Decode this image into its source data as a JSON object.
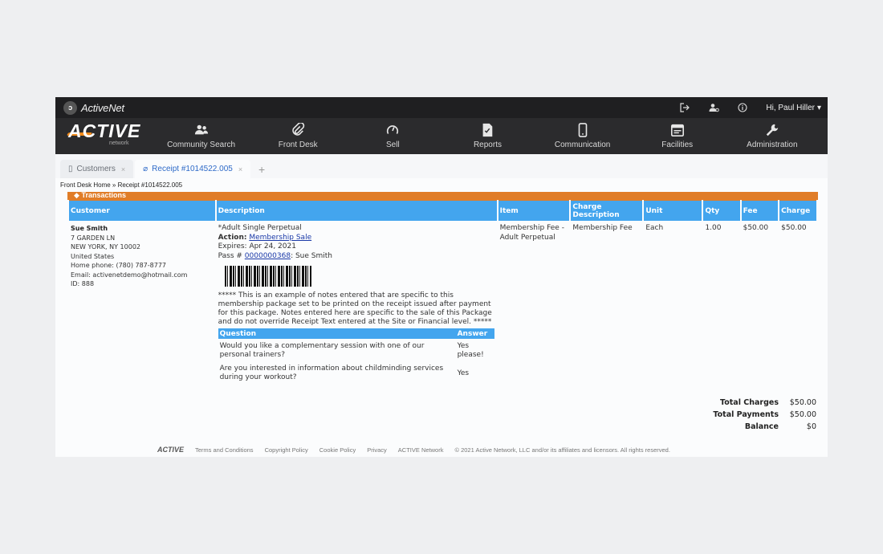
{
  "topbar": {
    "brand": "ActiveNet",
    "greeting": "Hi, Paul Hiller"
  },
  "logo": {
    "main": "ACTIVE",
    "sub": "network"
  },
  "nav": [
    {
      "label": "Community Search",
      "icon": "people-icon"
    },
    {
      "label": "Front Desk",
      "icon": "paperclip-icon"
    },
    {
      "label": "Sell",
      "icon": "gauge-icon"
    },
    {
      "label": "Reports",
      "icon": "report-icon"
    },
    {
      "label": "Communication",
      "icon": "phone-icon"
    },
    {
      "label": "Facilities",
      "icon": "calendar-icon"
    },
    {
      "label": "Administration",
      "icon": "wrench-icon"
    }
  ],
  "tabs": [
    {
      "label": "Customers",
      "active": false
    },
    {
      "label": "Receipt #1014522.005",
      "active": true
    }
  ],
  "breadcrumb": "Front Desk Home » Receipt #1014522.005",
  "section_title": "Transactions",
  "table": {
    "headers": [
      "Customer",
      "Description",
      "Item",
      "Charge Description",
      "Unit",
      "Qty",
      "Fee",
      "Charge"
    ],
    "customer": {
      "name": "Sue Smith",
      "lines": [
        "7 GARDEN LN",
        "NEW YORK, NY 10002",
        "United States",
        "Home phone: (780) 787-8777",
        "Email: activenetdemo@hotmail.com",
        "ID: 888"
      ]
    },
    "description": {
      "title": "*Adult Single Perpetual",
      "action_label": "Action:",
      "action_link": "Membership Sale",
      "expires": "Expires: Apr 24, 2021",
      "pass_label": "Pass #",
      "pass_link": "0000000368",
      "pass_name": ": Sue Smith",
      "notes": "***** This is an example of notes entered that are specific to this membership package set to be printed on the receipt issued after payment for this package. Notes entered here are specific to the sale of this Package and do not override Receipt Text entered at the Site or Financial level. *****",
      "qa_headers": [
        "Question",
        "Answer"
      ],
      "qa": [
        {
          "q": "Would you like a complementary session with one of our personal trainers?",
          "a": "Yes please!"
        },
        {
          "q": "Are you interested in information about childminding services during your workout?",
          "a": "Yes"
        }
      ]
    },
    "item": "Membership Fee - Adult Perpetual",
    "charge_description": "Membership Fee",
    "unit": "Each",
    "qty": "1.00",
    "fee": "$50.00",
    "charge": "$50.00"
  },
  "totals": [
    {
      "label": "Total Charges",
      "value": "$50.00"
    },
    {
      "label": "Total Payments",
      "value": "$50.00"
    },
    {
      "label": "Balance",
      "value": "$0"
    }
  ],
  "footer": {
    "logo": "ACTIVE",
    "links": [
      "Terms and Conditions",
      "Copyright Policy",
      "Cookie Policy",
      "Privacy",
      "ACTIVE Network"
    ],
    "copyright": "© 2021 Active Network, LLC and/or its affiliates and licensors. All rights reserved."
  },
  "colors": {
    "accent": "#43a5ee",
    "orange": "#e07d28",
    "header": "#1f1f21"
  }
}
